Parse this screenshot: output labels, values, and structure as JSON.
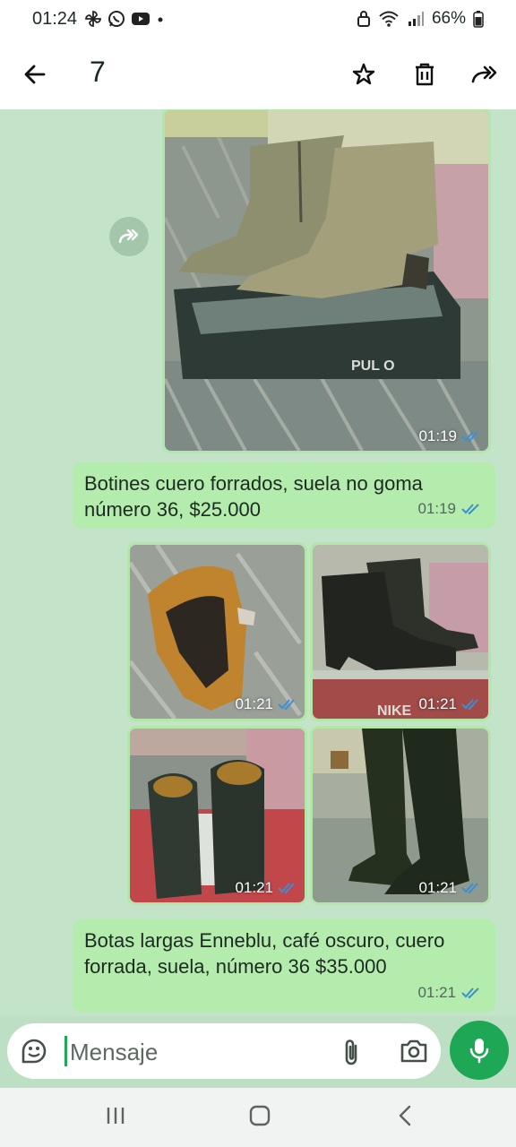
{
  "status_bar": {
    "time": "01:24",
    "battery": "66%"
  },
  "header": {
    "selected_count": "7"
  },
  "messages": [
    {
      "type": "image",
      "time": "01:19"
    },
    {
      "type": "text",
      "text_line1": "Botines cuero forrados, suela no goma",
      "text_line2": "número 36, $25.000",
      "time": "01:19"
    },
    {
      "type": "image_grid",
      "times": [
        "01:21",
        "01:21",
        "01:21",
        "01:21"
      ]
    },
    {
      "type": "text",
      "text_line1": "Botas largas Enneblu, café oscuro, cuero",
      "text_line2": "forrada, suela, número 36 $35.000",
      "time": "01:21"
    }
  ],
  "image_text": {
    "box_brand": "PUL   O",
    "box_brand2": "NIKE"
  },
  "composer": {
    "placeholder": "Mensaje"
  },
  "colors": {
    "accent": "#1ea754",
    "bubble": "#b4ecae",
    "ticks": "#3a8fd6"
  }
}
